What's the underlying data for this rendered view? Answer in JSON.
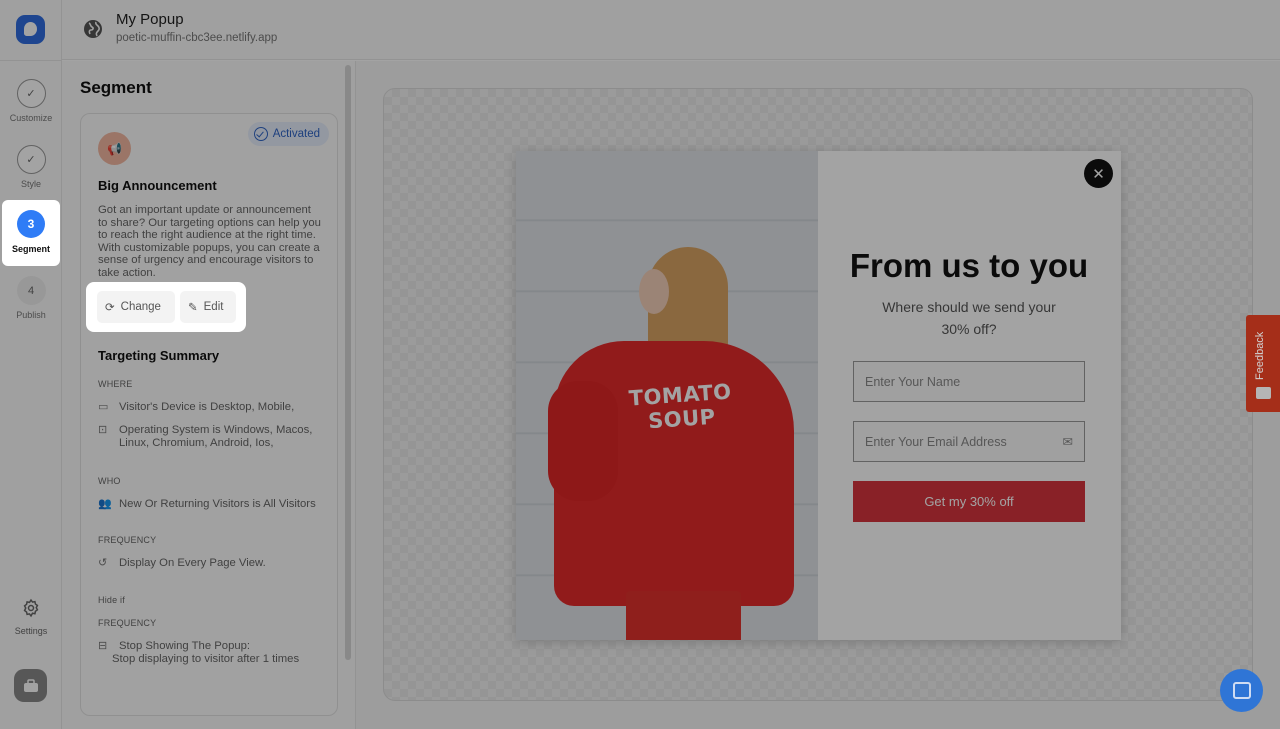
{
  "header": {
    "title": "My Popup",
    "url": "poetic-muffin-cbc3ee.netlify.app"
  },
  "rail": {
    "steps": [
      {
        "label": "Customize",
        "state": "done"
      },
      {
        "label": "Style",
        "state": "done"
      },
      {
        "label": "Segment",
        "number": "3",
        "state": "active"
      },
      {
        "label": "Publish",
        "number": "4",
        "state": "pending"
      }
    ],
    "settings_label": "Settings"
  },
  "panel": {
    "heading": "Segment",
    "card": {
      "badge": "Activated",
      "title": "Big Announcement",
      "description": "Got an important update or announcement to share? Our targeting options can help you to reach the right audience at the right time. With customizable popups, you can create a sense of urgency and encourage visitors to take action.",
      "change_label": "Change",
      "edit_label": "Edit",
      "summary_title": "Targeting Summary",
      "where_label": "WHERE",
      "where_items": [
        "Visitor's Device is Desktop, Mobile,",
        "Operating System is Windows, Macos, Linux, Chromium, Android, Ios,"
      ],
      "who_label": "WHO",
      "who_items": [
        "New Or Returning Visitors is All Visitors"
      ],
      "frequency_label": "FREQUENCY",
      "frequency_items": [
        "Display On Every Page View."
      ],
      "hide_if_label": "Hide if",
      "hide_frequency_label": "FREQUENCY",
      "hide_item_title": "Stop Showing The Popup:",
      "hide_item_detail": "Stop displaying to visitor after 1 times"
    }
  },
  "popup": {
    "image_print_line1": "TOMATO",
    "image_print_line2": "SOUP",
    "headline": "From us to you",
    "subtext": "Where should we send your 30% off?",
    "name_placeholder": "Enter Your Name",
    "email_placeholder": "Enter Your Email Address",
    "cta_label": "Get my 30% off"
  },
  "feedback_label": "Feedback",
  "colors": {
    "accent": "#2f7cf6",
    "cta": "#d6343d",
    "feedback": "#c9381f",
    "badge_text": "#2f64c6"
  }
}
